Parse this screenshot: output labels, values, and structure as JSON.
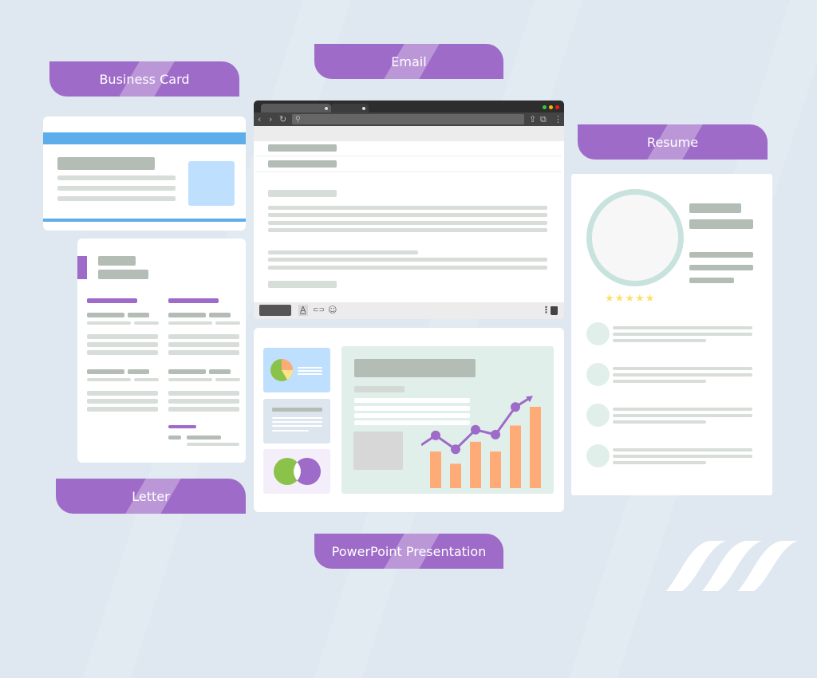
{
  "labels": {
    "business_card": "Business Card",
    "email": "Email",
    "resume": "Resume",
    "letter": "Letter",
    "presentation": "PowerPoint Presentation"
  },
  "colors": {
    "accent": "#9e6bc8",
    "business_blue": "#5eadeb",
    "photo_blue": "#bfdfff",
    "bar_orange": "#ffab78",
    "star_yellow": "#ffdf6b",
    "pie_green": "#8bc34a",
    "window_dots": [
      "#2ecc40",
      "#f4b400",
      "#e8201b"
    ]
  },
  "icons": {
    "back": "‹",
    "forward": "›",
    "reload": "↻",
    "search": "⚲",
    "share": "⇪",
    "copy": "⧉",
    "menu": "⋮",
    "text_format": "A",
    "link": "⊂⊃",
    "emoji": "☺",
    "more": "⋮",
    "trash": "🗑",
    "star": "★"
  },
  "resume": {
    "rating": 5,
    "rating_max": 5
  },
  "presentation_chart": {
    "bars": [
      0.45,
      0.3,
      0.57,
      0.45,
      0.77,
      1.0
    ],
    "line": [
      0.55,
      0.38,
      0.62,
      0.56,
      0.9,
      1.0
    ]
  }
}
